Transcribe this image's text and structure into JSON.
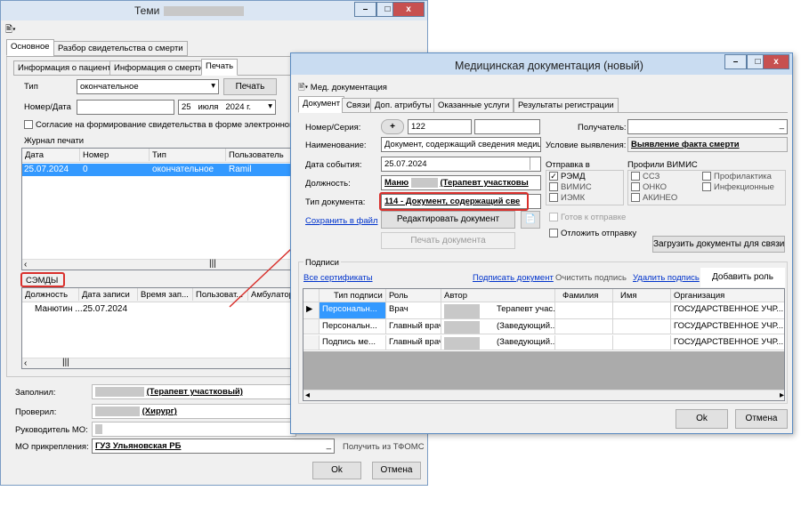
{
  "bg_win": {
    "title": "Теми",
    "main_tabs": [
      "Основное",
      "Разбор свидетельства о смерти"
    ],
    "sub_tabs": [
      "Информация о пациенте",
      "Информация о смерти",
      "Печать"
    ],
    "type_label": "Тип",
    "type_value": "окончательное",
    "print_btn": "Печать",
    "num_date_label": "Номер/Дата",
    "date_day": "25",
    "date_month": "июля",
    "date_year": "2024 г.",
    "consent": "Согласие на формирование свидетельства в форме электронного до",
    "journal_label": "Журнал печати",
    "journal_cols": [
      "Дата",
      "Номер",
      "Тип",
      "Пользователь"
    ],
    "journal_row": [
      "25.07.2024",
      "0",
      "окончательное",
      "Ramil"
    ],
    "semd_label": "СЭМДЫ",
    "semd_cols": [
      "Должность",
      "Дата записи",
      "Время зап...",
      "Пользоват...",
      "Амбулатор"
    ],
    "semd_row": [
      "Манютин ...",
      "25.07.2024"
    ],
    "filled_label": "Заполнил:",
    "filled_value": "(Терапевт участковый)",
    "checked_label": "Проверил:",
    "checked_value": "(Хирург)",
    "head_label": "Руководитель МО:",
    "mo_label": "МО прикрепления:",
    "mo_value": "ГУЗ Ульяновская РБ",
    "tfoms_btn": "Получить из ТФОМС",
    "ok": "Ok",
    "cancel": "Отмена"
  },
  "fg_win": {
    "title": "Медицинская документация (новый)",
    "menu": "Мед. документация",
    "tabs": [
      "Документ",
      "Связи",
      "Доп. атрибуты",
      "Оказанные услуги",
      "Результаты регистрации"
    ],
    "num_label": "Номер/Серия:",
    "num_value": "122",
    "receiver_label": "Получатель:",
    "name_label": "Наименование:",
    "name_value": "Документ, содержащий сведения медицин",
    "condition_label": "Условие выявления:",
    "condition_value": "Выявление факта смерти",
    "event_label": "Дата события:",
    "event_value": "25.07.2024",
    "position_label": "Должность:",
    "position_prefix": "Маню",
    "position_value": "(Терапевт участковы",
    "doctype_label": "Тип документа:",
    "doctype_value": "114 - Документ, содержащий све",
    "save_link": "Сохранить в файл",
    "edit_btn": "Редактировать документ",
    "print_btn": "Печать документа",
    "send_label": "Отправка в",
    "send_options": [
      {
        "label": "РЭМД",
        "checked": true
      },
      {
        "label": "ВИМИС",
        "checked": false
      },
      {
        "label": "ИЭМК",
        "checked": false
      }
    ],
    "vimis_label": "Профили ВИМИС",
    "vimis_col1": [
      "ССЗ",
      "ОНКО",
      "АКИНЕО"
    ],
    "vimis_col2": [
      "Профилактика",
      "Инфекционные"
    ],
    "ready_label": "Готов к отправке",
    "defer_label": "Отложить отправку",
    "load_btn": "Загрузить документы для связи",
    "signs_label": "Подписи",
    "all_certs": "Все сертификаты",
    "sign_doc": "Подписать документ",
    "clear_sign": "Очистить подпись",
    "delete_sign": "Удалить подпись",
    "add_role": "Добавить роль",
    "sign_cols": [
      "Тип подписи",
      "Роль",
      "Автор",
      "Фамилия",
      "Имя",
      "Организация"
    ],
    "sign_rows": [
      {
        "type": "Персональн...",
        "role": "Врач",
        "author": "Терапевт учас...",
        "org": "ГОСУДАРСТВЕННОЕ УЧР..."
      },
      {
        "type": "Персональн...",
        "role": "Главный врач",
        "author": "(Заведующий...",
        "org": "ГОСУДАРСТВЕННОЕ УЧР..."
      },
      {
        "type": "Подпись ме...",
        "role": "Главный врач",
        "author": "(Заведующий...",
        "org": "ГОСУДАРСТВЕННОЕ УЧР..."
      }
    ],
    "ok": "Ok",
    "cancel": "Отмена"
  },
  "colors": {
    "accent": "#3399ff",
    "highlight": "#d9302c",
    "link": "#0033cc"
  }
}
